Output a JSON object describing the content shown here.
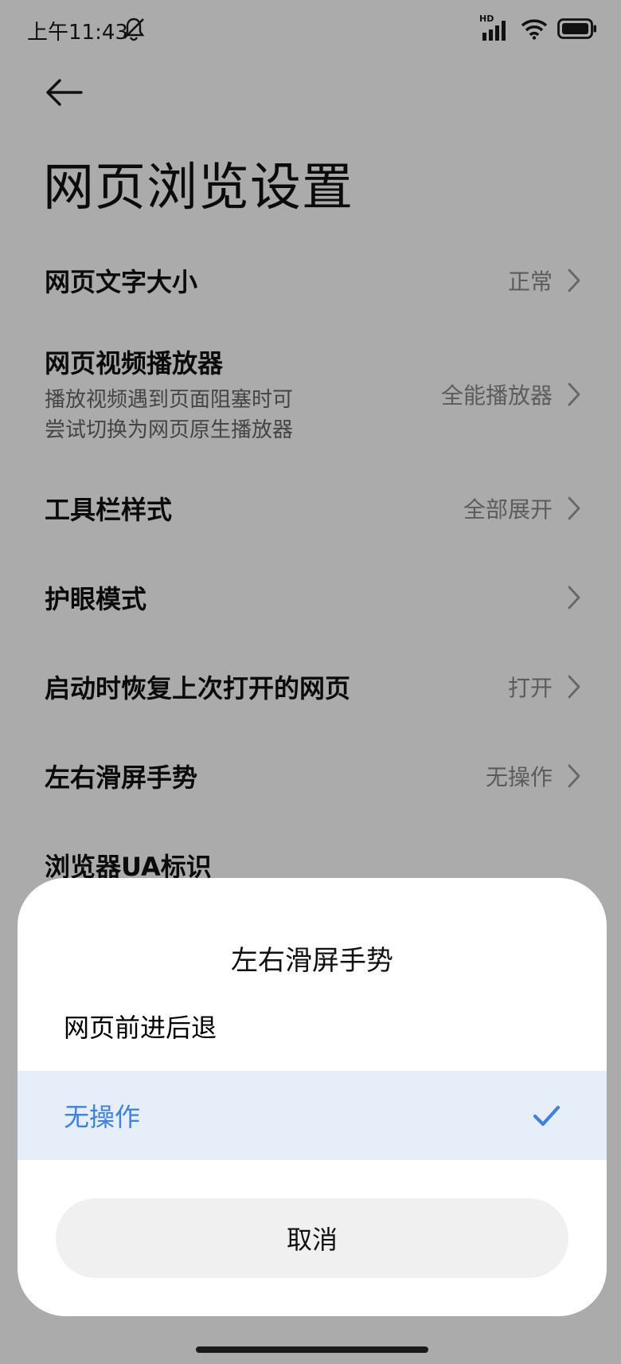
{
  "status_bar": {
    "time": "上午11:43",
    "network": "HD"
  },
  "header": {
    "title": "网页浏览设置"
  },
  "settings": [
    {
      "label": "网页文字大小",
      "value": "正常"
    },
    {
      "label": "网页视频播放器",
      "sub_line1": "播放视频遇到页面阻塞时可",
      "sub_line2": "尝试切换为网页原生播放器",
      "value": "全能播放器"
    },
    {
      "label": "工具栏样式",
      "value": "全部展开"
    },
    {
      "label": "护眼模式",
      "value": ""
    },
    {
      "label": "启动时恢复上次打开的网页",
      "value": "打开"
    },
    {
      "label": "左右滑屏手势",
      "value": "无操作"
    },
    {
      "label": "浏览器UA标识",
      "value": ""
    }
  ],
  "dialog": {
    "title": "左右滑屏手势",
    "options": [
      {
        "label": "网页前进后退",
        "selected": false
      },
      {
        "label": "无操作",
        "selected": true
      }
    ],
    "cancel_label": "取消"
  },
  "colors": {
    "accent": "#3b82e4",
    "selected_bg": "#e6eef9",
    "scrim": "rgba(0,0,0,0.33)"
  }
}
